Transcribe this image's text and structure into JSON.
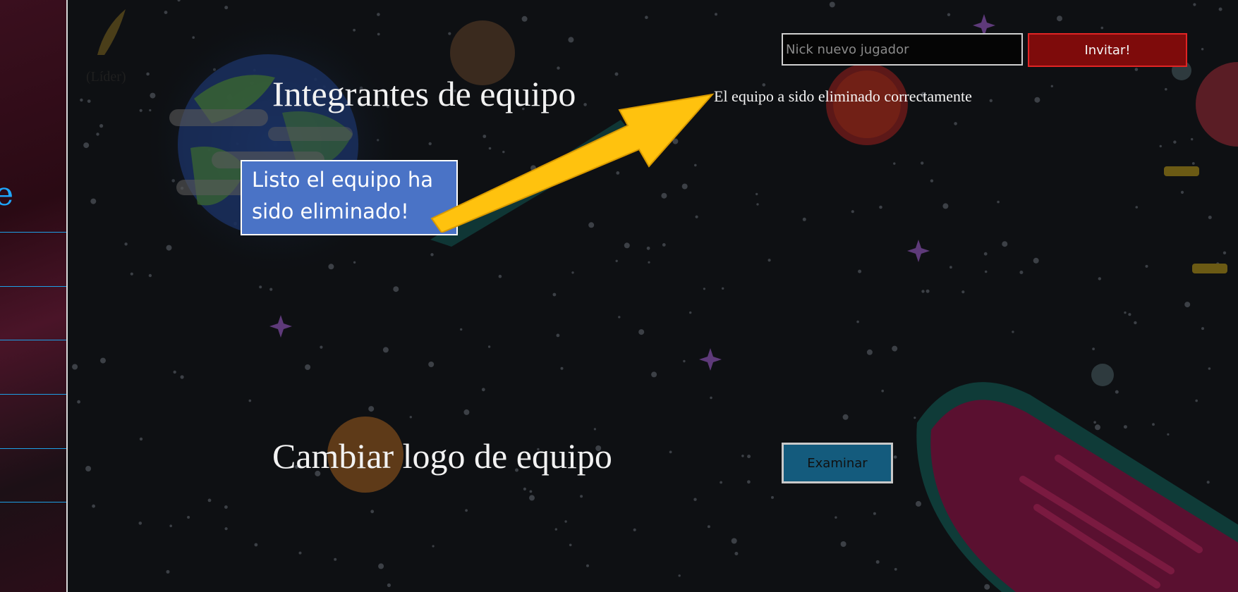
{
  "team": {
    "leader_label": "(Líder)",
    "members_heading": "Integrantes de equipo",
    "logo_heading": "Cambiar logo de equipo"
  },
  "invite": {
    "placeholder": "Nick nuevo jugador",
    "button_label": "Invitar!"
  },
  "status": {
    "message": "El equipo a sido eliminado correctamente"
  },
  "logo": {
    "browse_label": "Examinar"
  },
  "sidebar": {
    "partial_glyph": "e"
  },
  "annotation": {
    "callout_text": "Listo el equipo ha sido eliminado!"
  },
  "colors": {
    "background": "#0e1013",
    "accent_blue": "#1da0e6",
    "invite_red": "#7e0b0b",
    "browse_blue": "#145b7d",
    "callout_blue": "#4a73c6",
    "arrow_yellow": "#ffc20e"
  }
}
